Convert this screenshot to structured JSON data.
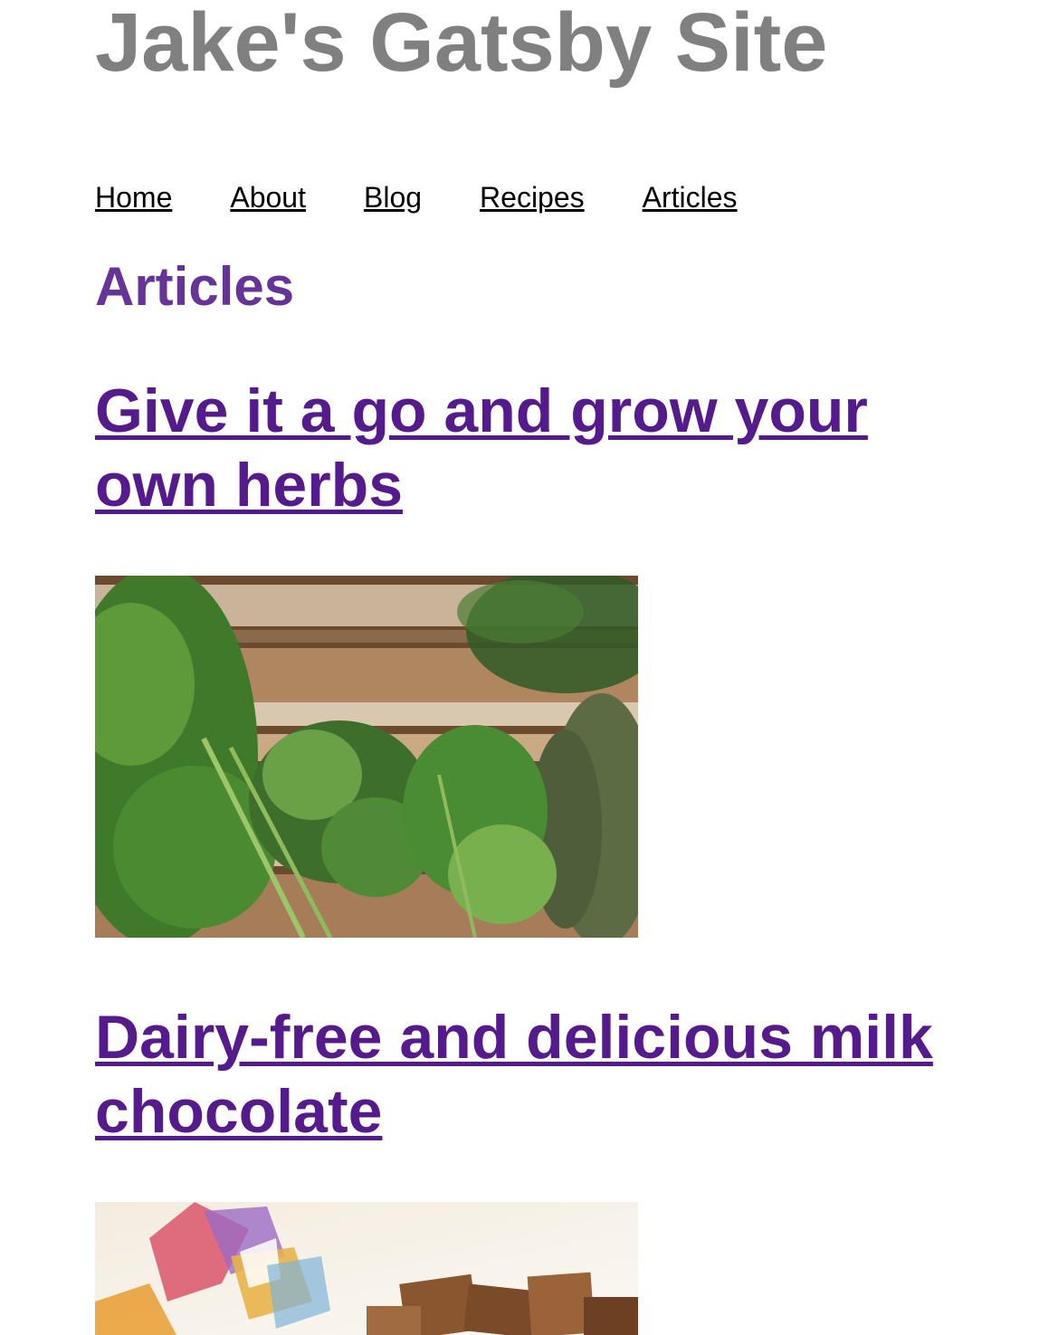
{
  "site": {
    "title": "Jake's Gatsby Site"
  },
  "nav": {
    "items": [
      {
        "label": "Home"
      },
      {
        "label": "About"
      },
      {
        "label": "Blog"
      },
      {
        "label": "Recipes"
      },
      {
        "label": "Articles"
      }
    ]
  },
  "page": {
    "heading": "Articles"
  },
  "articles": [
    {
      "title": "Give it a go and grow your own herbs",
      "image_subject": "fresh herbs on a wooden crate"
    },
    {
      "title": "Dairy-free and delicious milk chocolate",
      "image_subject": "milk chocolate pieces with colorful wrapper"
    }
  ],
  "colors": {
    "site_title": "#808080",
    "heading": "#663399",
    "link_visited": "#551a8b",
    "nav_link": "#000000"
  }
}
